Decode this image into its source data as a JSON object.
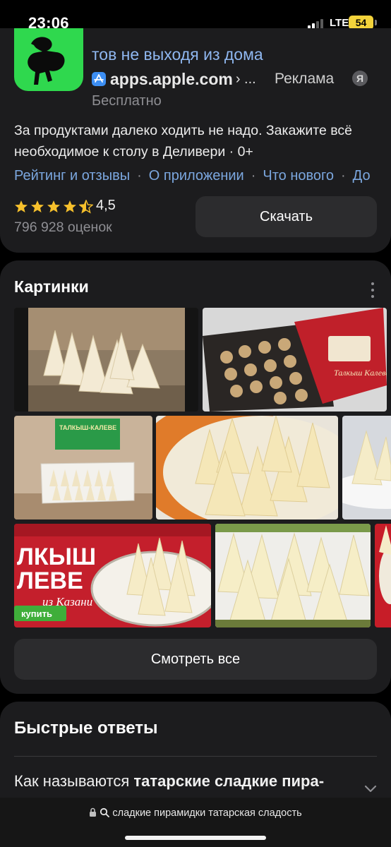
{
  "status_bar": {
    "time": "23:06",
    "network": "LTE",
    "battery": "54"
  },
  "ad": {
    "title": "тов не выходя из дома",
    "source": "apps.apple.com",
    "source_sep": "› ...",
    "label": "Реклама",
    "badge": "Я",
    "price": "Бесплатно",
    "description": "За продуктами далеко ходить не надо. Закажите всё необходимое к столу в Деливери · 0+",
    "links": [
      "Рейтинг и отзывы",
      "О приложении",
      "Что нового",
      "До"
    ],
    "rating": "4,5",
    "rating_stars": 4.5,
    "rating_count": "796 928 оценок",
    "download_label": "Скачать",
    "accent_color": "#8fb7f0"
  },
  "images": {
    "title": "Картинки",
    "see_all_label": "Смотреть все",
    "thumbs": [
      {
        "name": "image-thumb-1"
      },
      {
        "name": "image-thumb-2",
        "box_text": "Талкыш Калеве"
      },
      {
        "name": "image-thumb-3",
        "box_text": "ТАЛКЫШ-КАЛЕВЕ"
      },
      {
        "name": "image-thumb-4"
      },
      {
        "name": "image-thumb-5"
      },
      {
        "name": "image-thumb-6",
        "banner_line1": "ЛКЫШ",
        "banner_line2": "ЛЕВЕ",
        "banner_line3": "из Казани",
        "banner_button": "купить"
      },
      {
        "name": "image-thumb-7"
      },
      {
        "name": "image-thumb-8"
      }
    ]
  },
  "quick_answers": {
    "title": "Быстрые ответы",
    "question_plain": "Как называются ",
    "question_bold": "татарские сладкие пира-"
  },
  "url_bar": {
    "text": "сладкие пирамидки татарская сладость"
  }
}
